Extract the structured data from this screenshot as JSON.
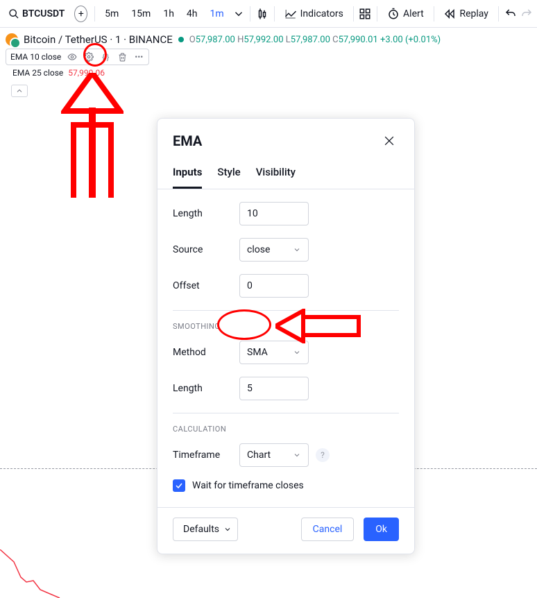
{
  "toolbar": {
    "symbol": "BTCUSDT",
    "intervals": [
      "5m",
      "15m",
      "1h",
      "4h",
      "1m"
    ],
    "active_interval_index": 4,
    "indicators_label": "Indicators",
    "alert_label": "Alert",
    "replay_label": "Replay"
  },
  "symbol_info": {
    "title": "Bitcoin / TetherUS · 1 · BINANCE",
    "o": "57,987.00",
    "h": "57,992.00",
    "l": "57,987.00",
    "c": "57,990.01",
    "change": "+3.00",
    "change_pct": "(+0.01%)"
  },
  "legends": [
    {
      "name": "EMA 10 close"
    },
    {
      "name": "EMA 25 close",
      "value": "57,990.06"
    }
  ],
  "dialog": {
    "title": "EMA",
    "tabs": [
      "Inputs",
      "Style",
      "Visibility"
    ],
    "active_tab": 0,
    "inputs": {
      "length_label": "Length",
      "length_value": "10",
      "source_label": "Source",
      "source_value": "close",
      "offset_label": "Offset",
      "offset_value": "0"
    },
    "smoothing": {
      "section": "SMOOTHING",
      "method_label": "Method",
      "method_value": "SMA",
      "length_label": "Length",
      "length_value": "5"
    },
    "calculation": {
      "section": "CALCULATION",
      "timeframe_label": "Timeframe",
      "timeframe_value": "Chart",
      "wait_label": "Wait for timeframe closes"
    },
    "defaults_label": "Defaults",
    "cancel_label": "Cancel",
    "ok_label": "Ok"
  }
}
